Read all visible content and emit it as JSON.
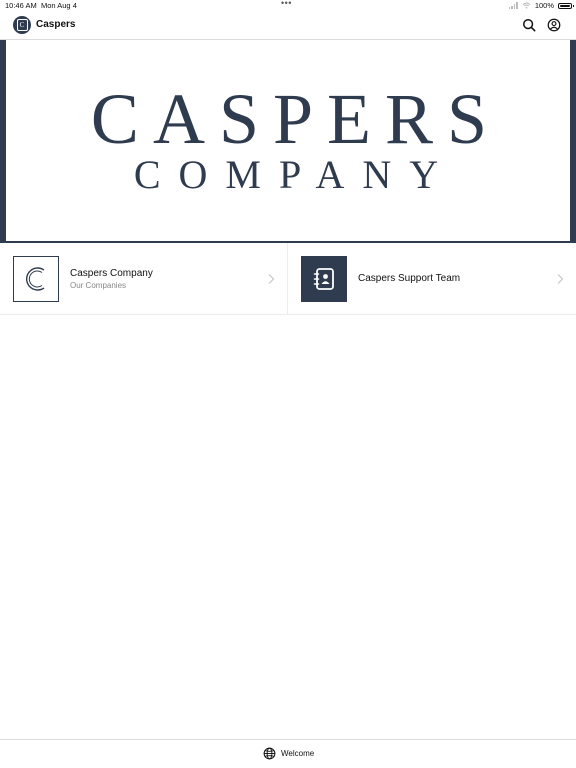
{
  "status_bar": {
    "time": "10:46 AM",
    "date": "Mon Aug 4",
    "battery": "100%"
  },
  "nav": {
    "title": "Caspers",
    "logo_letter": "C"
  },
  "banner": {
    "line1": "CASPERS",
    "line2": "COMPANY"
  },
  "tiles": [
    {
      "name": "Caspers Company",
      "subtitle": "Our Companies",
      "thumb_letter": "C"
    },
    {
      "name": "Caspers Support Team",
      "subtitle": ""
    }
  ],
  "tab_bar": {
    "tabs": [
      {
        "label": "Welcome",
        "icon": "globe-icon"
      }
    ]
  },
  "colors": {
    "brand": "#2f3b4f",
    "background": "#ffffff",
    "divider": "#dcdcdc",
    "muted_text": "#888888"
  },
  "icons": [
    "search-icon",
    "profile-icon",
    "chevron-right-icon",
    "contact-book-icon",
    "globe-icon",
    "battery-icon",
    "wifi-icon",
    "signal-icon"
  ]
}
